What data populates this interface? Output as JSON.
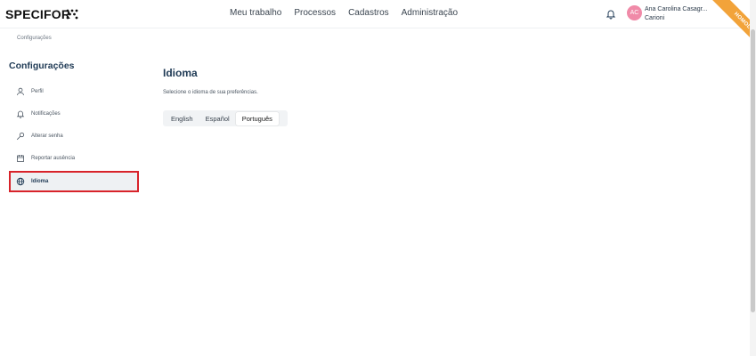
{
  "header": {
    "logo_text": "SPECIFOR",
    "nav": [
      "Meu trabalho",
      "Processos",
      "Cadastros",
      "Administração"
    ],
    "user": {
      "initials": "AC",
      "name_line1": "Ana Carolina Casagr...",
      "name_line2": "Carioni"
    },
    "env_ribbon": "HOMOLOG",
    "ribbon_color": "#f2a33a",
    "avatar_color": "#f08aa8"
  },
  "breadcrumb": "Configurações",
  "sidebar": {
    "title": "Configurações",
    "items": [
      {
        "label": "Perfil",
        "icon": "user-icon"
      },
      {
        "label": "Notificações",
        "icon": "bell-icon"
      },
      {
        "label": "Alterar senha",
        "icon": "key-icon"
      },
      {
        "label": "Reportar ausência",
        "icon": "calendar-icon"
      },
      {
        "label": "Idioma",
        "icon": "globe-icon",
        "active": true
      }
    ]
  },
  "main": {
    "title": "Idioma",
    "description": "Selecione o idioma de sua preferências.",
    "languages": [
      "English",
      "Español",
      "Português"
    ],
    "selected_language": "Português"
  }
}
